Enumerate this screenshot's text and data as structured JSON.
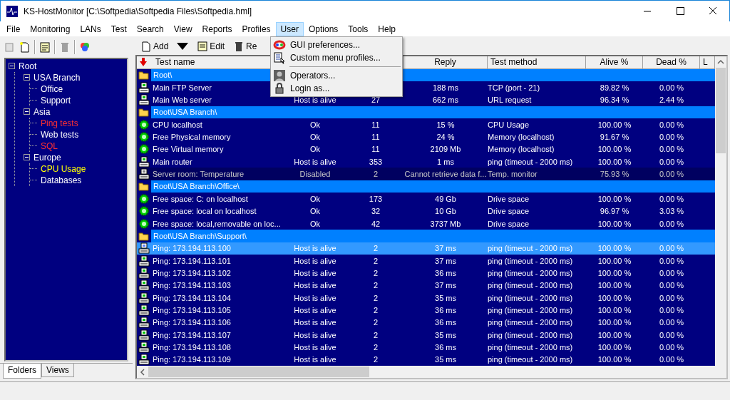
{
  "window": {
    "title": "KS-HostMonitor  [C:\\Softpedia\\Softpedia Files\\Softpedia.hml]"
  },
  "menubar": [
    {
      "label": "File",
      "selected": false
    },
    {
      "label": "Monitoring",
      "selected": false
    },
    {
      "label": "LANs",
      "selected": false
    },
    {
      "label": "Test",
      "selected": false
    },
    {
      "label": "Search",
      "selected": false
    },
    {
      "label": "View",
      "selected": false
    },
    {
      "label": "Reports",
      "selected": false
    },
    {
      "label": "Profiles",
      "selected": false
    },
    {
      "label": "User",
      "selected": true
    },
    {
      "label": "Options",
      "selected": false
    },
    {
      "label": "Tools",
      "selected": false
    },
    {
      "label": "Help",
      "selected": false
    }
  ],
  "user_menu": [
    {
      "kind": "item",
      "label": "GUI preferences..."
    },
    {
      "kind": "item",
      "label": "Custom menu profiles..."
    },
    {
      "kind": "separator"
    },
    {
      "kind": "item",
      "label": "Operators..."
    },
    {
      "kind": "item",
      "label": "Login as..."
    }
  ],
  "toolbar": [
    {
      "label": "Add",
      "dropdown": true
    },
    {
      "label": "Edit",
      "dropdown": false
    },
    {
      "label": "Re",
      "dropdown": false
    }
  ],
  "tree": [
    {
      "label": "Root",
      "color": "#ffffff",
      "children": [
        {
          "label": "USA Branch",
          "color": "#ffffff",
          "children": [
            {
              "label": "Office",
              "color": "#ffffff"
            },
            {
              "label": "Support",
              "color": "#ffffff"
            }
          ]
        },
        {
          "label": "Asia",
          "color": "#ffffff",
          "children": [
            {
              "label": "Ping tests",
              "color": "#ff3030"
            },
            {
              "label": "Web tests",
              "color": "#ffffff"
            },
            {
              "label": "SQL",
              "color": "#ff3030"
            }
          ]
        },
        {
          "label": "Europe",
          "color": "#ffffff",
          "children": [
            {
              "label": "CPU Usage",
              "color": "#ffff00"
            },
            {
              "label": "Databases",
              "color": "#ffffff"
            }
          ]
        }
      ]
    }
  ],
  "left_tabs": [
    {
      "label": "Folders",
      "selected": true
    },
    {
      "label": "Views",
      "selected": false
    }
  ],
  "table": {
    "columns": [
      "Test name",
      "Reply",
      "Test method",
      "Alive %",
      "Dead %",
      "L"
    ],
    "rows": [
      {
        "kind": "folder",
        "name": "Root\\"
      },
      {
        "kind": "host",
        "name": "Main FTP Server",
        "reply": "188 ms",
        "method": "TCP (port - 21)",
        "alive": "89.82 %",
        "dead": "0.00 %",
        "selected": false,
        "disabled": false
      },
      {
        "kind": "host",
        "name": "Main Web server",
        "status": "Host is alive",
        "count": "27",
        "reply": "662 ms",
        "method": "URL request",
        "alive": "96.34 %",
        "dead": "2.44 %",
        "selected": false,
        "disabled": false
      },
      {
        "kind": "folder",
        "name": "Root\\USA Branch\\"
      },
      {
        "kind": "sensor",
        "name": "CPU localhost",
        "status": "Ok",
        "count": "11",
        "reply": "15 %",
        "method": "CPU Usage",
        "alive": "100.00 %",
        "dead": "0.00 %",
        "selected": false,
        "disabled": false
      },
      {
        "kind": "sensor",
        "name": "Free Physical memory",
        "status": "Ok",
        "count": "11",
        "reply": "24 %",
        "method": "Memory (localhost)",
        "alive": "91.67 %",
        "dead": "0.00 %",
        "selected": false,
        "disabled": false
      },
      {
        "kind": "sensor",
        "name": "Free Virtual memory",
        "status": "Ok",
        "count": "11",
        "reply": "2109 Mb",
        "method": "Memory (localhost)",
        "alive": "100.00 %",
        "dead": "0.00 %",
        "selected": false,
        "disabled": false
      },
      {
        "kind": "host",
        "name": "Main router",
        "status": "Host is alive",
        "count": "353",
        "reply": "1 ms",
        "method": "ping (timeout - 2000 ms)",
        "alive": "100.00 %",
        "dead": "0.00 %",
        "selected": false,
        "disabled": false
      },
      {
        "kind": "host",
        "name": "Server room: Temperature",
        "status": "Disabled",
        "count": "2",
        "reply": "Cannot retrieve data f...",
        "method": "Temp. monitor",
        "alive": "75.93 %",
        "dead": "0.00 %",
        "selected": false,
        "disabled": true
      },
      {
        "kind": "folder",
        "name": "Root\\USA Branch\\Office\\"
      },
      {
        "kind": "sensor",
        "name": "Free space: C: on localhost",
        "status": "Ok",
        "count": "173",
        "reply": "49 Gb",
        "method": "Drive space",
        "alive": "100.00 %",
        "dead": "0.00 %",
        "selected": false,
        "disabled": false
      },
      {
        "kind": "sensor",
        "name": "Free space: local on localhost",
        "status": "Ok",
        "count": "32",
        "reply": "10 Gb",
        "method": "Drive space",
        "alive": "96.97 %",
        "dead": "3.03 %",
        "selected": false,
        "disabled": false
      },
      {
        "kind": "sensor",
        "name": "Free space: local,removable on loc...",
        "status": "Ok",
        "count": "42",
        "reply": "3737 Mb",
        "method": "Drive space",
        "alive": "100.00 %",
        "dead": "0.00 %",
        "selected": false,
        "disabled": false
      },
      {
        "kind": "folder",
        "name": "Root\\USA Branch\\Support\\"
      },
      {
        "kind": "host",
        "name": "Ping: 173.194.113.100",
        "status": "Host is alive",
        "count": "2",
        "reply": "37 ms",
        "method": "ping (timeout - 2000 ms)",
        "alive": "100.00 %",
        "dead": "0.00 %",
        "selected": true,
        "disabled": false
      },
      {
        "kind": "host",
        "name": "Ping: 173.194.113.101",
        "status": "Host is alive",
        "count": "2",
        "reply": "37 ms",
        "method": "ping (timeout - 2000 ms)",
        "alive": "100.00 %",
        "dead": "0.00 %",
        "selected": false,
        "disabled": false
      },
      {
        "kind": "host",
        "name": "Ping: 173.194.113.102",
        "status": "Host is alive",
        "count": "2",
        "reply": "36 ms",
        "method": "ping (timeout - 2000 ms)",
        "alive": "100.00 %",
        "dead": "0.00 %",
        "selected": false,
        "disabled": false
      },
      {
        "kind": "host",
        "name": "Ping: 173.194.113.103",
        "status": "Host is alive",
        "count": "2",
        "reply": "37 ms",
        "method": "ping (timeout - 2000 ms)",
        "alive": "100.00 %",
        "dead": "0.00 %",
        "selected": false,
        "disabled": false
      },
      {
        "kind": "host",
        "name": "Ping: 173.194.113.104",
        "status": "Host is alive",
        "count": "2",
        "reply": "35 ms",
        "method": "ping (timeout - 2000 ms)",
        "alive": "100.00 %",
        "dead": "0.00 %",
        "selected": false,
        "disabled": false
      },
      {
        "kind": "host",
        "name": "Ping: 173.194.113.105",
        "status": "Host is alive",
        "count": "2",
        "reply": "36 ms",
        "method": "ping (timeout - 2000 ms)",
        "alive": "100.00 %",
        "dead": "0.00 %",
        "selected": false,
        "disabled": false
      },
      {
        "kind": "host",
        "name": "Ping: 173.194.113.106",
        "status": "Host is alive",
        "count": "2",
        "reply": "36 ms",
        "method": "ping (timeout - 2000 ms)",
        "alive": "100.00 %",
        "dead": "0.00 %",
        "selected": false,
        "disabled": false
      },
      {
        "kind": "host",
        "name": "Ping: 173.194.113.107",
        "status": "Host is alive",
        "count": "2",
        "reply": "35 ms",
        "method": "ping (timeout - 2000 ms)",
        "alive": "100.00 %",
        "dead": "0.00 %",
        "selected": false,
        "disabled": false
      },
      {
        "kind": "host",
        "name": "Ping: 173.194.113.108",
        "status": "Host is alive",
        "count": "2",
        "reply": "36 ms",
        "method": "ping (timeout - 2000 ms)",
        "alive": "100.00 %",
        "dead": "0.00 %",
        "selected": false,
        "disabled": false
      },
      {
        "kind": "host",
        "name": "Ping: 173.194.113.109",
        "status": "Host is alive",
        "count": "2",
        "reply": "35 ms",
        "method": "ping (timeout - 2000 ms)",
        "alive": "100.00 %",
        "dead": "0.00 %",
        "selected": false,
        "disabled": false
      }
    ]
  }
}
